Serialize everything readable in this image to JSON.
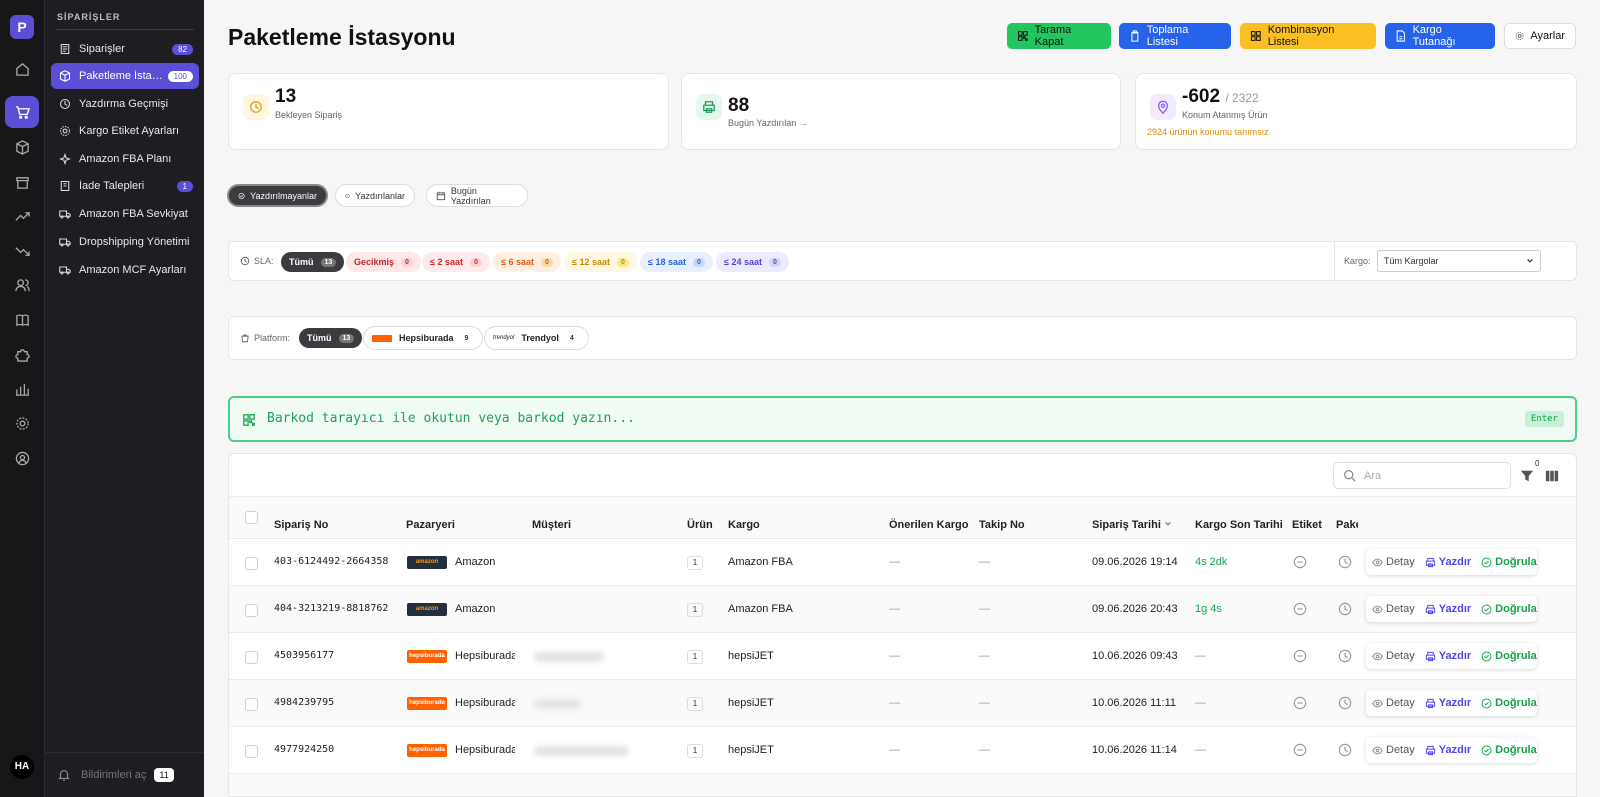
{
  "app": {
    "logo_letter": "P",
    "avatar_initials": "HA",
    "accent": "#5b4fd6"
  },
  "sidebar": {
    "section_title": "SİPARİŞLER",
    "items": [
      {
        "label": "Siparişler",
        "count": "82",
        "icon": "list-icon"
      },
      {
        "label": "Paketleme İstasyonu",
        "count": "100",
        "icon": "box-icon",
        "active": true
      },
      {
        "label": "Yazdırma Geçmişi",
        "count": "",
        "icon": "clock-icon"
      },
      {
        "label": "Kargo Etiket Ayarları",
        "count": "",
        "icon": "gear-icon"
      },
      {
        "label": "Amazon FBA Planı",
        "count": "",
        "icon": "sparkle-icon"
      },
      {
        "label": "İade Talepleri",
        "count": "1",
        "icon": "return-icon"
      },
      {
        "label": "Amazon FBA Sevkiyat",
        "count": "",
        "icon": "truck-icon"
      },
      {
        "label": "Dropshipping Yönetimi",
        "count": "",
        "icon": "truck-icon"
      },
      {
        "label": "Amazon MCF Ayarları",
        "count": "",
        "icon": "truck-icon"
      }
    ],
    "notifications_label": "Bildirimleri aç",
    "notifications_count": "11"
  },
  "header": {
    "title": "Paketleme İstasyonu",
    "buttons": {
      "scan_close": "Tarama Kapat",
      "pick_list": "Toplama Listesi",
      "combo_list": "Kombinasyon Listesi",
      "cargo_report": "Kargo Tutanağı",
      "settings": "Ayarlar"
    }
  },
  "stats": {
    "pending": {
      "value": "13",
      "label": "Bekleyen Sipariş"
    },
    "printed_today": {
      "value": "88",
      "label": "Bugün Yazdırılan",
      "arrow": "→"
    },
    "location": {
      "value": "-602",
      "total": "/ 2322",
      "label": "Konum Atanmış Ürün",
      "warning": "2924 ürünün konumu tanımsız"
    }
  },
  "print_tabs": [
    "Yazdırılmayanlar",
    "Yazdırılanlar",
    "Bugün Yazdırılan"
  ],
  "sla": {
    "label": "SLA:",
    "chips": [
      {
        "label": "Tümü",
        "count": "13"
      },
      {
        "label": "Gecikmiş",
        "count": "0"
      },
      {
        "label": "≤ 2 saat",
        "count": "0"
      },
      {
        "label": "≤ 6 saat",
        "count": "0"
      },
      {
        "label": "≤ 12 saat",
        "count": "0"
      },
      {
        "label": "≤ 18 saat",
        "count": "0"
      },
      {
        "label": "≤ 24 saat",
        "count": "0"
      }
    ],
    "cargo_label": "Kargo:",
    "cargo_selected": "Tüm Kargolar"
  },
  "platform": {
    "label": "Platform:",
    "chips": [
      {
        "label": "Tümü",
        "count": "13"
      },
      {
        "label": "Hepsiburada",
        "count": "9",
        "logo": "hepsiburada"
      },
      {
        "label": "Trendyol",
        "count": "4",
        "logo": "trendyol"
      }
    ]
  },
  "scan": {
    "placeholder": "Barkod tarayıcı ile okutun veya barkod yazın...",
    "enter_label": "Enter"
  },
  "table": {
    "search_placeholder": "Ara",
    "filter_count": "0",
    "columns": [
      "Sipariş No",
      "Pazaryeri",
      "Müşteri",
      "Ürün",
      "Kargo",
      "Önerilen Kargo",
      "Takip No",
      "Sipariş Tarihi",
      "Kargo Son Tarihi",
      "Etiket",
      "Paket"
    ],
    "actions": {
      "detail": "Detay",
      "print": "Yazdır",
      "verify": "Doğrula"
    },
    "rows": [
      {
        "order": "403-6124492-2664358",
        "market": "Amazon",
        "logo": "amazon",
        "qty": "1",
        "cargo": "Amazon FBA",
        "suggested": "—",
        "tracking": "—",
        "date": "09.06.2026 19:14",
        "deadline": "4s 2dk"
      },
      {
        "order": "404-3213219-8818762",
        "market": "Amazon",
        "logo": "amazon",
        "qty": "1",
        "cargo": "Amazon FBA",
        "suggested": "—",
        "tracking": "—",
        "date": "09.06.2026 20:43",
        "deadline": "1g 4s"
      },
      {
        "order": "4503956177",
        "market": "Hepsiburada",
        "logo": "hepsiburada",
        "qty": "1",
        "cargo": "hepsiJET",
        "suggested": "—",
        "tracking": "—",
        "date": "10.06.2026 09:43",
        "deadline": "—"
      },
      {
        "order": "4984239795",
        "market": "Hepsiburada",
        "logo": "hepsiburada",
        "qty": "1",
        "cargo": "hepsiJET",
        "suggested": "—",
        "tracking": "—",
        "date": "10.06.2026 11:11",
        "deadline": "—"
      },
      {
        "order": "4977924250",
        "market": "Hepsiburada",
        "logo": "hepsiburada",
        "qty": "1",
        "cargo": "hepsiJET",
        "suggested": "—",
        "tracking": "—",
        "date": "10.06.2026 11:14",
        "deadline": "—"
      }
    ]
  }
}
